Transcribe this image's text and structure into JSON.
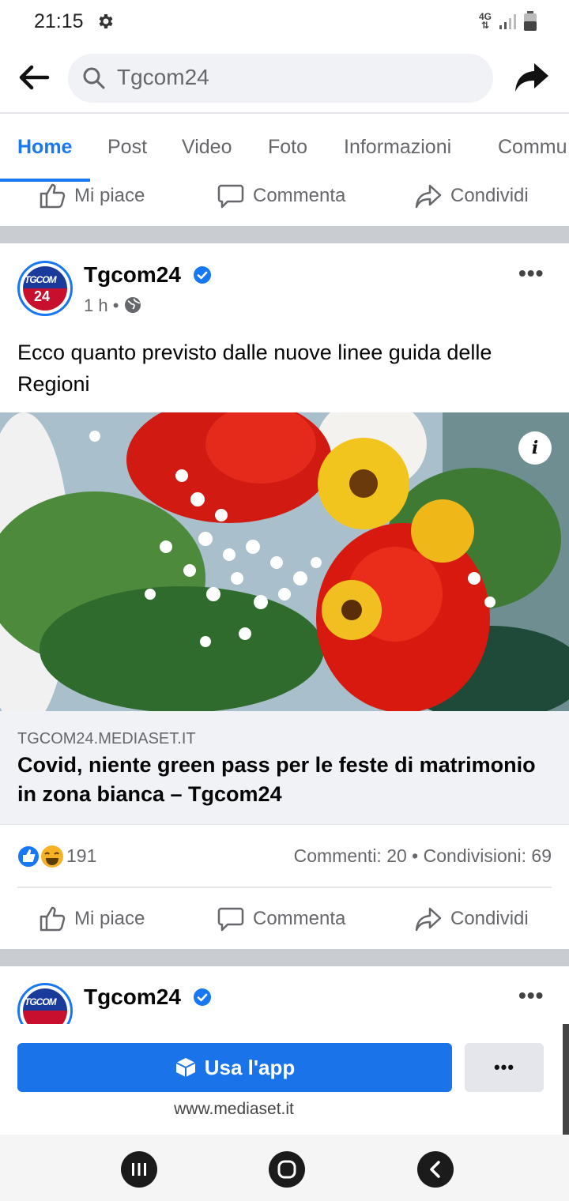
{
  "status_bar": {
    "time": "21:15",
    "network": "4G"
  },
  "search": {
    "value": "Tgcom24"
  },
  "tabs": [
    "Home",
    "Post",
    "Video",
    "Foto",
    "Informazioni",
    "Commu"
  ],
  "actions": {
    "like": "Mi piace",
    "comment": "Commenta",
    "share": "Condividi"
  },
  "post": {
    "page_name": "Tgcom24",
    "avatar_text": [
      "TGCOM",
      "24"
    ],
    "time": "1 h",
    "separator": "•",
    "text": "Ecco quanto previsto dalle nuove linee guida delle Regioni",
    "link": {
      "domain": "TGCOM24.MEDIASET.IT",
      "title": "Covid, niente green pass per le feste di matrimonio in zona bianca – Tgcom24"
    },
    "reactions_count": "191",
    "stats": "Commenti: 20 • Condivisioni: 69",
    "info_glyph": "i",
    "more_glyph": "•••"
  },
  "next_post": {
    "page_name": "Tgcom24",
    "more_glyph": "•••"
  },
  "banner": {
    "use_app": "Usa l'app",
    "more": "•••",
    "site": "www.mediaset.it"
  },
  "colors": {
    "accent": "#1877f2",
    "button": "#1a73e8",
    "separator": "#c9ccd1"
  }
}
